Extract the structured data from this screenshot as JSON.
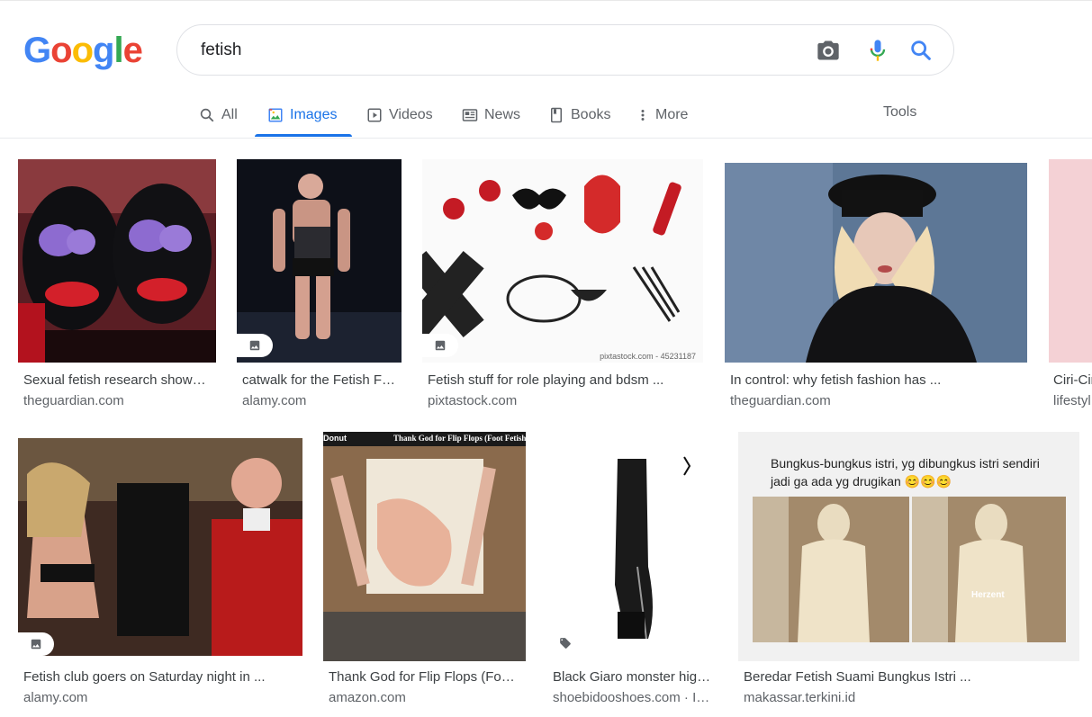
{
  "logo": {
    "letters": [
      "G",
      "o",
      "o",
      "g",
      "l",
      "e"
    ],
    "colors": [
      "#4285F4",
      "#EA4335",
      "#FBBC05",
      "#4285F4",
      "#34A853",
      "#EA4335"
    ]
  },
  "search": {
    "query": "fetish",
    "camera_icon": "camera-icon",
    "mic_icon": "microphone-icon",
    "search_icon": "search-icon"
  },
  "tabs": [
    {
      "label": "All",
      "icon": "search-icon",
      "active": false
    },
    {
      "label": "Images",
      "icon": "image-icon",
      "active": true
    },
    {
      "label": "Videos",
      "icon": "play-icon",
      "active": false
    },
    {
      "label": "News",
      "icon": "news-icon",
      "active": false
    },
    {
      "label": "Books",
      "icon": "book-icon",
      "active": false
    },
    {
      "label": "More",
      "icon": "more-vert-icon",
      "active": false
    }
  ],
  "tools_label": "Tools",
  "accent": "#1a73e8",
  "results": [
    {
      "title": "Sexual fetish research show…",
      "source": "theguardian.com"
    },
    {
      "title": "catwalk for the Fetish F…",
      "source": "alamy.com"
    },
    {
      "title": "Fetish stuff for role playing and bdsm ...",
      "source": "pixtastock.com",
      "watermark": "pixtastock.com - 45231187"
    },
    {
      "title": "In control: why fetish fashion has ...",
      "source": "theguardian.com"
    },
    {
      "title": "Ciri-Ciri",
      "source": "lifestyl"
    },
    {
      "title": "Fetish club goers on Saturday night in ...",
      "source": "alamy.com"
    },
    {
      "title": "Thank God for Flip Flops (Fo…",
      "source": "amazon.com",
      "overlay_left": "Donut",
      "overlay_right": "Thank God for Flip Flops (Foot Fetish Man"
    },
    {
      "title": "Black Giaro monster hig…",
      "source": "shoebidooshoes.com · I…"
    },
    {
      "title": "Beredar Fetish Suami Bungkus Istri ...",
      "source": "makassar.terkini.id",
      "caption": "Bungkus-bungkus istri, yg dibungkus istri sendiri jadi ga ada yg drugikan 😊😊😊",
      "watermark": "Herzent"
    }
  ]
}
